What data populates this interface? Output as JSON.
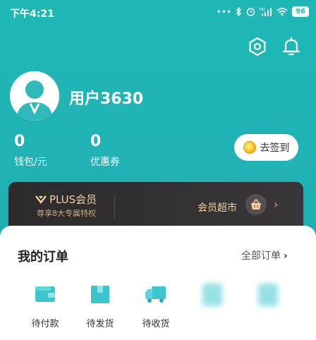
{
  "status_bar": {
    "time": "下午4:21",
    "battery": "96",
    "indicators": [
      "more-dots-icon",
      "bluetooth-icon",
      "alarm-icon",
      "hd-signal-icon",
      "wifi-icon",
      "battery-icon"
    ]
  },
  "header": {
    "icons": [
      "settings-icon",
      "bell-icon"
    ]
  },
  "profile": {
    "username": "用户3630",
    "avatar_icon": "default-avatar-icon"
  },
  "stats": {
    "wallet_value": "0",
    "wallet_label": "钱包/元",
    "coupon_value": "0",
    "coupon_label": "优惠券"
  },
  "checkin": {
    "label": "去签到",
    "icon": "coin-icon"
  },
  "plus": {
    "title": "PLUS会员",
    "subtitle": "尊享8大专属特权",
    "market_label": "会员超市",
    "arrow": "›"
  },
  "orders": {
    "title": "我的订单",
    "all_label": "全部订单",
    "all_arrow": "›",
    "items": [
      {
        "label": "待付款",
        "icon": "wallet-icon"
      },
      {
        "label": "待发货",
        "icon": "package-icon"
      },
      {
        "label": "待收货",
        "icon": "truck-icon"
      }
    ]
  },
  "colors": {
    "header": "#1fb7b6",
    "accent_teal": "#38c8cd",
    "plus_gold": "#f0d1a3",
    "plus_bg": "#2c2a2b"
  }
}
